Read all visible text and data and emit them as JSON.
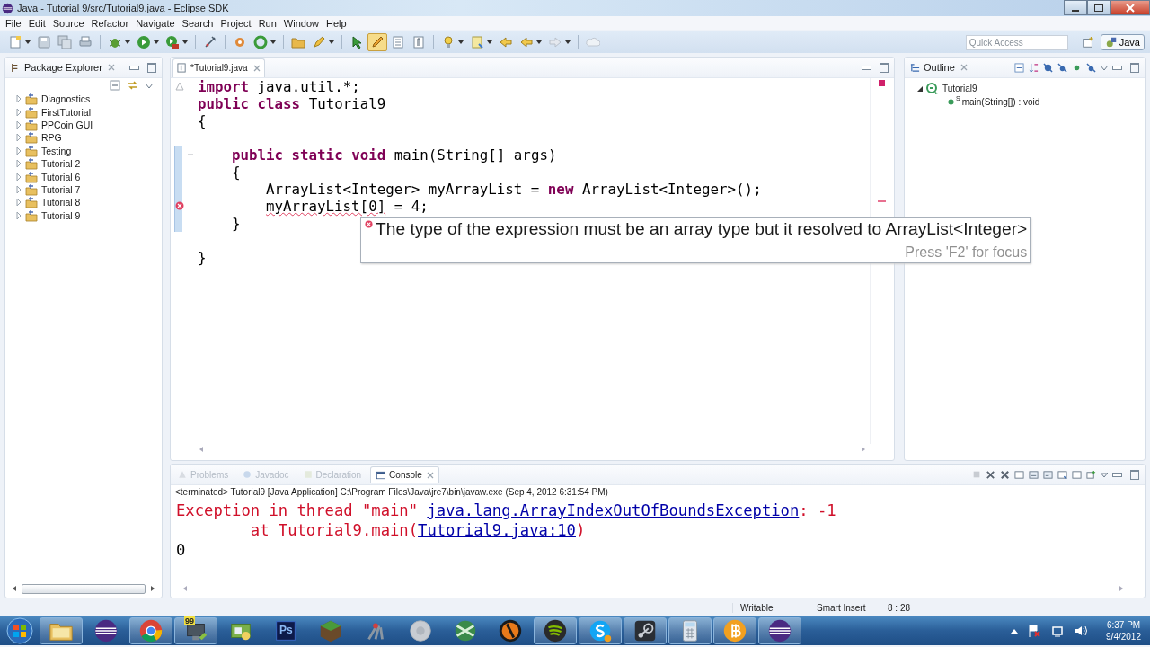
{
  "window": {
    "title": "Java - Tutorial 9/src/Tutorial9.java - Eclipse SDK"
  },
  "menu": [
    "File",
    "Edit",
    "Source",
    "Refactor",
    "Navigate",
    "Search",
    "Project",
    "Run",
    "Window",
    "Help"
  ],
  "toolbar": {
    "buttons": [
      {
        "kind": "page",
        "pressed": false,
        "dropdown": true
      },
      {
        "kind": "disk",
        "pressed": false,
        "dropdown": false
      },
      {
        "kind": "disks",
        "pressed": false,
        "dropdown": false
      },
      {
        "kind": "printer",
        "pressed": false,
        "dropdown": false
      },
      {
        "kind": "separator"
      },
      {
        "kind": "bug",
        "pressed": false,
        "dropdown": true
      },
      {
        "kind": "play",
        "pressed": false,
        "dropdown": true
      },
      {
        "kind": "play-box",
        "pressed": false,
        "dropdown": true
      },
      {
        "kind": "separator"
      },
      {
        "kind": "pin",
        "pressed": false,
        "dropdown": false
      },
      {
        "kind": "separator"
      },
      {
        "kind": "gear",
        "pressed": false,
        "dropdown": false
      },
      {
        "kind": "refresh",
        "pressed": false,
        "dropdown": true
      },
      {
        "kind": "separator"
      },
      {
        "kind": "folder",
        "pressed": false,
        "dropdown": false
      },
      {
        "kind": "pen",
        "pressed": false,
        "dropdown": true
      },
      {
        "kind": "separator"
      },
      {
        "kind": "pointer",
        "pressed": false,
        "dropdown": false
      },
      {
        "kind": "highlighter",
        "pressed": true,
        "dropdown": false
      },
      {
        "kind": "grid",
        "pressed": false,
        "dropdown": false
      },
      {
        "kind": "pilcrow",
        "pressed": false,
        "dropdown": false
      },
      {
        "kind": "separator"
      },
      {
        "kind": "bulb",
        "pressed": false,
        "dropdown": true
      },
      {
        "kind": "note",
        "pressed": false,
        "dropdown": true
      },
      {
        "kind": "arrow-left",
        "pressed": false,
        "dropdown": false
      },
      {
        "kind": "arrow-left",
        "pressed": false,
        "dropdown": true
      },
      {
        "kind": "arrow-right",
        "pressed": false,
        "dropdown": true
      },
      {
        "kind": "separator"
      },
      {
        "kind": "cloud",
        "pressed": false,
        "dropdown": false
      }
    ],
    "quick_access": {
      "placeholder": "Quick Access"
    },
    "perspectives": [
      {
        "label": "Java",
        "selected": true
      }
    ]
  },
  "package_explorer": {
    "title": "Package Explorer",
    "projects": [
      {
        "name": "Diagnostics",
        "expanded": false
      },
      {
        "name": "FirstTutorial",
        "expanded": false
      },
      {
        "name": "PPCoin GUI",
        "expanded": false
      },
      {
        "name": "RPG",
        "expanded": false
      },
      {
        "name": "Testing",
        "expanded": false
      },
      {
        "name": "Tutorial 2",
        "expanded": false
      },
      {
        "name": "Tutorial 6",
        "expanded": false
      },
      {
        "name": "Tutorial 7",
        "expanded": false
      },
      {
        "name": "Tutorial 8",
        "expanded": false
      },
      {
        "name": "Tutorial 9",
        "expanded": false
      }
    ]
  },
  "editor": {
    "tab": {
      "title": "*Tutorial9.java"
    },
    "lines": [
      {
        "warning": true,
        "error": false,
        "fold": false,
        "changed": false,
        "segments": [
          {
            "text": "import",
            "kind": "keyword"
          },
          {
            "text": " java.util.*;",
            "kind": "plain"
          }
        ]
      },
      {
        "warning": false,
        "error": false,
        "fold": false,
        "changed": false,
        "segments": [
          {
            "text": "public class",
            "kind": "keyword"
          },
          {
            "text": " Tutorial9",
            "kind": "plain"
          }
        ]
      },
      {
        "warning": false,
        "error": false,
        "fold": false,
        "changed": false,
        "segments": [
          {
            "text": "{",
            "kind": "plain"
          }
        ],
        "children": [
          {
            "warning": false,
            "error": false,
            "fold": false,
            "changed": false
          },
          {
            "warning": false,
            "error": false,
            "fold": true,
            "changed": true,
            "segments": [
              {
                "text": "public static void",
                "kind": "keyword"
              },
              {
                "text": " main(String[] args)",
                "kind": "plain"
              }
            ]
          },
          {
            "warning": false,
            "error": false,
            "fold": false,
            "changed": true,
            "segments": [
              {
                "text": "{",
                "kind": "plain"
              }
            ],
            "children": [
              {
                "warning": false,
                "error": false,
                "fold": false,
                "changed": true,
                "segments": [
                  {
                    "text": "ArrayList<Integer> myArrayList = ",
                    "kind": "plain"
                  },
                  {
                    "text": "new",
                    "kind": "keyword"
                  },
                  {
                    "text": " ArrayList<Integer>();",
                    "kind": "plain"
                  }
                ]
              },
              {
                "warning": false,
                "error": true,
                "fold": false,
                "changed": true,
                "segments": [
                  {
                    "text": "myArrayList[0]",
                    "kind": "error"
                  },
                  {
                    "text": " = 4;",
                    "kind": "plain"
                  }
                ]
              }
            ]
          },
          {
            "warning": false,
            "error": false,
            "fold": false,
            "changed": true,
            "segments": [
              {
                "text": "}",
                "kind": "plain"
              }
            ]
          },
          {
            "warning": false,
            "error": false,
            "fold": false,
            "changed": false
          }
        ]
      },
      {
        "warning": false,
        "error": false,
        "fold": false,
        "changed": false,
        "segments": [
          {
            "text": "}",
            "kind": "plain"
          }
        ]
      }
    ],
    "tooltip": {
      "message": "The type of the expression must be an array type but it resolved to ArrayList<Integer>",
      "hint": "Press 'F2' for focus"
    }
  },
  "outline": {
    "title": "Outline",
    "tree": [
      {
        "label": "Tutorial9",
        "expanded": true,
        "children": [
          {
            "label": "main(String[]) : void",
            "decorator": "S"
          }
        ]
      }
    ]
  },
  "console_panel": {
    "tabs": [
      {
        "label": "Problems",
        "selected": false,
        "kind": "problems"
      },
      {
        "label": "Javadoc",
        "selected": false,
        "kind": "javadoc"
      },
      {
        "label": "Declaration",
        "selected": false,
        "kind": "declaration"
      },
      {
        "label": "Console",
        "selected": true,
        "kind": "console"
      }
    ],
    "header": "<terminated> Tutorial9 [Java Application] C:\\Program Files\\Java\\jre7\\bin\\javaw.exe (Sep 4, 2012 6:31:54 PM)",
    "lines": [
      {
        "segments": [
          {
            "text": "Exception in thread \"main\" ",
            "kind": "error"
          },
          {
            "text": "java.lang.ArrayIndexOutOfBoundsException",
            "kind": "link"
          },
          {
            "text": ": -1",
            "kind": "error"
          }
        ]
      },
      {
        "segments": [
          {
            "text": "        at Tutorial9.main(",
            "kind": "error"
          },
          {
            "text": "Tutorial9.java:10",
            "kind": "link"
          },
          {
            "text": ")",
            "kind": "error"
          }
        ]
      },
      {
        "segments": [
          {
            "text": "0",
            "kind": "plain"
          }
        ]
      }
    ]
  },
  "status_bar": [
    "Writable",
    "Smart Insert",
    "8 : 28"
  ],
  "taskbar": {
    "items": [
      {
        "kind": "folder",
        "running": true
      },
      {
        "kind": "eclipse",
        "running": false
      },
      {
        "kind": "chrome",
        "running": true
      },
      {
        "kind": "monitor",
        "running": true,
        "badge": "99"
      },
      {
        "kind": "network",
        "running": false
      },
      {
        "kind": "photoshop",
        "running": false,
        "label": "Ps"
      },
      {
        "kind": "cube",
        "running": false
      },
      {
        "kind": "tools",
        "running": false
      },
      {
        "kind": "grey-globe",
        "running": false
      },
      {
        "kind": "green-globe",
        "running": false
      },
      {
        "kind": "orange-disc",
        "running": false
      },
      {
        "kind": "spotify",
        "running": true
      },
      {
        "kind": "skype",
        "running": true
      },
      {
        "kind": "steam",
        "running": true
      },
      {
        "kind": "calculator",
        "running": true
      },
      {
        "kind": "bitcoin",
        "running": true
      },
      {
        "kind": "eclipse",
        "running": true
      }
    ],
    "clock": {
      "time": "6:37 PM",
      "date": "9/4/2012"
    }
  }
}
